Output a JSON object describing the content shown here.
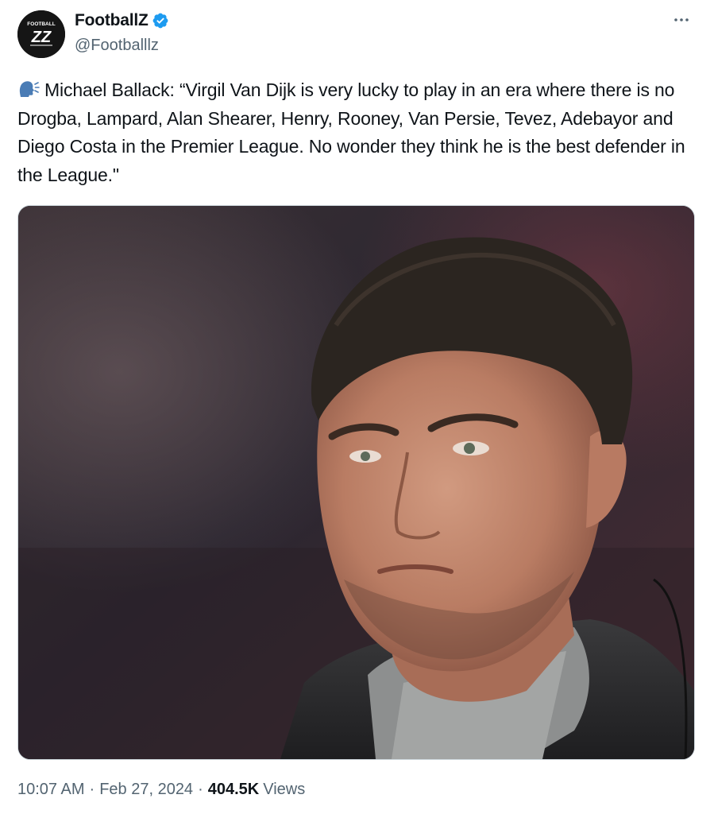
{
  "author": {
    "display_name": "FootballZ",
    "handle": "@Footballlz",
    "verified": true,
    "verified_color": "#1d9bf0",
    "avatar_text": "FOOTBALL",
    "avatar_monogram": "ZZ"
  },
  "menu": {
    "more_icon": "ellipsis-icon"
  },
  "tweet": {
    "emoji_icon": "speaking-head-icon",
    "text": "Michael Ballack: “Virgil Van Dijk is very lucky to play in an era where there is no Drogba, Lampard, Alan Shearer, Henry, Rooney, Van Persie, Tevez, Adebayor and Diego Costa in the Premier League. No wonder they think he is the best defender in the League.\""
  },
  "media": {
    "type": "photo",
    "subject": "portrait-photo"
  },
  "meta": {
    "time": "10:07 AM",
    "separator": "·",
    "date": "Feb 27, 2024",
    "views_count": "404.5K",
    "views_label": "Views"
  }
}
